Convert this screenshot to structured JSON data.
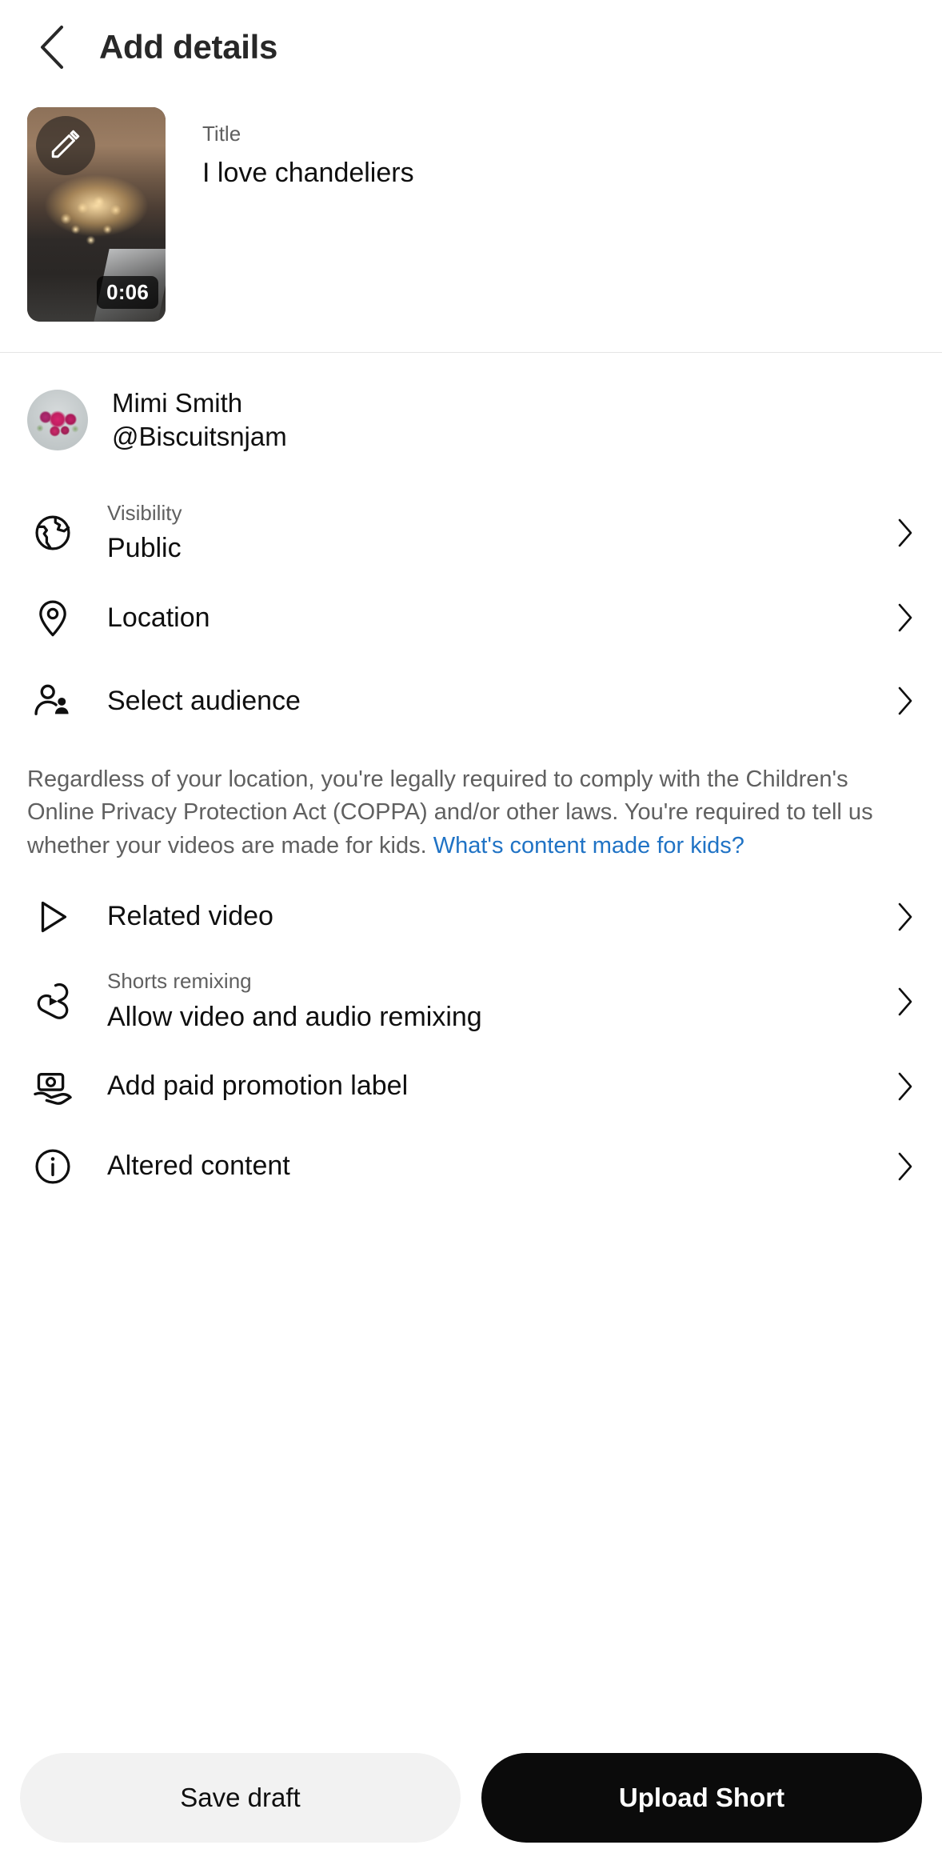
{
  "header": {
    "title": "Add details",
    "back_icon": "chevron-left-icon"
  },
  "video": {
    "edit_icon": "pencil-icon",
    "duration": "0:06",
    "title_label": "Title",
    "title_value": "I love chandeliers"
  },
  "channel": {
    "name": "Mimi Smith",
    "handle": "@Biscuitsnjam",
    "avatar_icon": "avatar"
  },
  "options": [
    {
      "icon": "globe-icon",
      "sub": "Visibility",
      "main": "Public",
      "chevron": "chevron-right-icon"
    },
    {
      "icon": "location-pin-icon",
      "sub": "",
      "main": "Location",
      "chevron": "chevron-right-icon"
    },
    {
      "icon": "audience-people-icon",
      "sub": "",
      "main": "Select audience",
      "chevron": "chevron-right-icon"
    },
    {
      "icon": "play-triangle-icon",
      "sub": "",
      "main": "Related video",
      "chevron": "chevron-right-icon"
    },
    {
      "icon": "shorts-remix-icon",
      "sub": "Shorts remixing",
      "main": "Allow video and audio remixing",
      "chevron": "chevron-right-icon"
    },
    {
      "icon": "paid-promotion-icon",
      "sub": "",
      "main": "Add paid promotion label",
      "chevron": "chevron-right-icon"
    },
    {
      "icon": "info-circle-icon",
      "sub": "",
      "main": "Altered content",
      "chevron": "chevron-right-icon"
    }
  ],
  "coppa": {
    "text": "Regardless of your location, you're legally required to comply with the Children's Online Privacy Protection Act (COPPA) and/or other laws. You're required to tell us whether your videos are made for kids. ",
    "link": "What's content made for kids?"
  },
  "footer": {
    "save_draft": "Save draft",
    "upload": "Upload Short"
  },
  "colors": {
    "link": "#2073c5",
    "primary_button": "#0b0b0b",
    "secondary_button": "#f2f2f2",
    "text_primary": "#0f0f0f",
    "text_secondary": "#606060"
  }
}
